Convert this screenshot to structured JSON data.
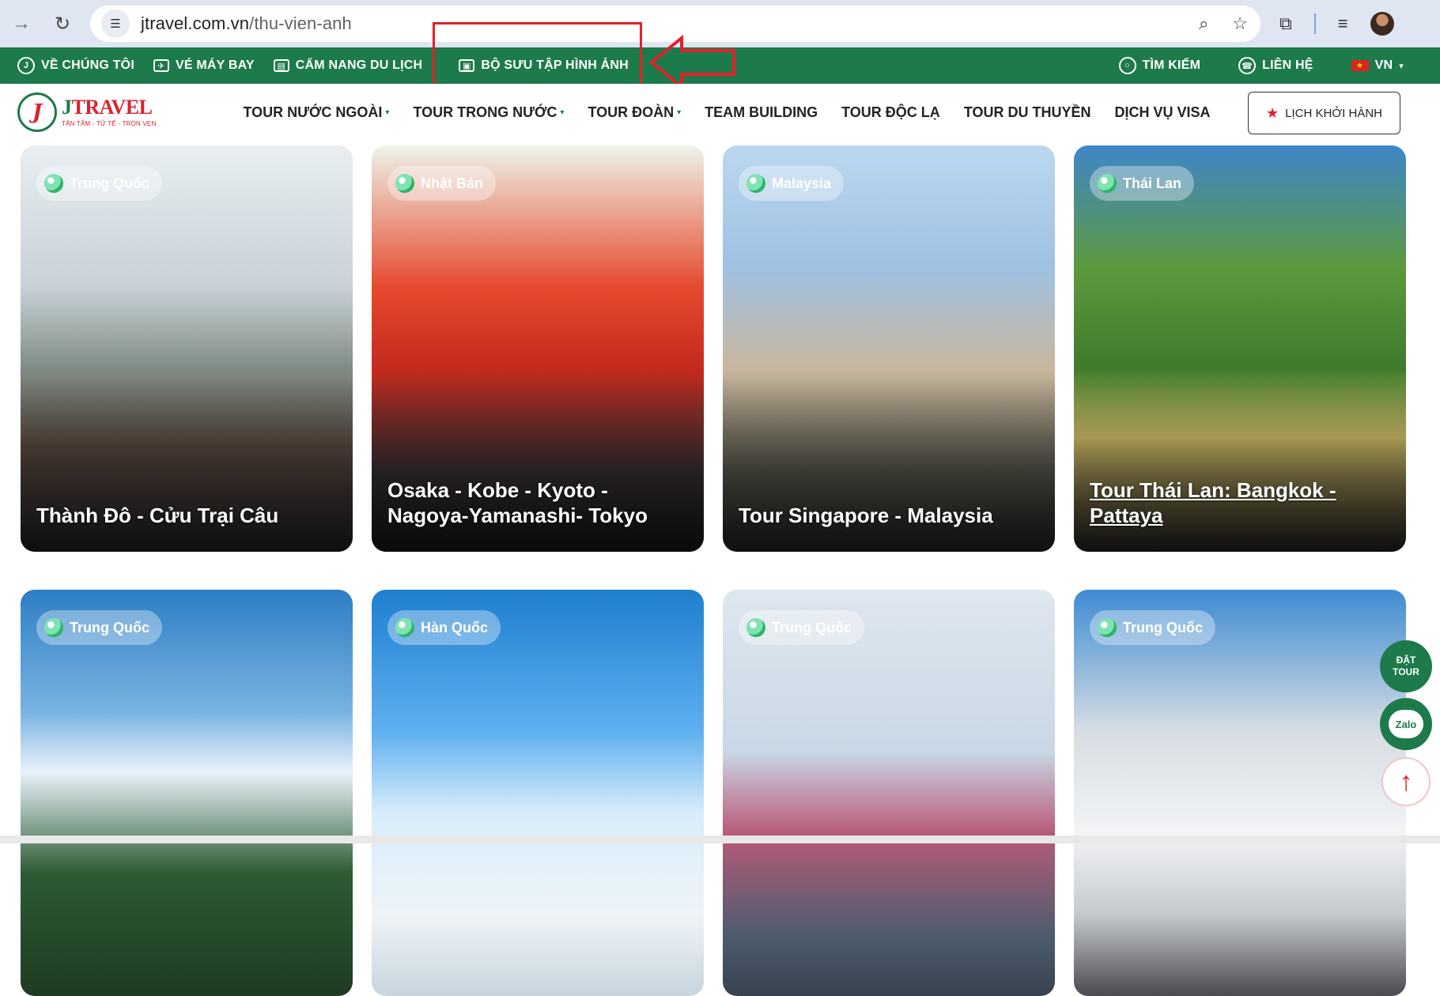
{
  "browser": {
    "url_host": "jtravel.com.vn",
    "url_path": "/thu-vien-anh",
    "icons": [
      "forward-icon",
      "reload-icon",
      "site-info-icon",
      "zoom-icon",
      "bookmark-star-icon",
      "extensions-icon",
      "media-icon",
      "profile-avatar"
    ]
  },
  "topbar": {
    "left": [
      {
        "label": "VỀ CHÚNG TÔI",
        "icon": "logo-icon"
      },
      {
        "label": "VÉ MÁY BAY",
        "icon": "ticket-icon"
      },
      {
        "label": "CẨM NANG DU LỊCH",
        "icon": "book-icon"
      },
      {
        "label": "BỘ SƯU TẬP HÌNH ẢNH",
        "icon": "image-icon"
      }
    ],
    "right": [
      {
        "label": "TÌM KIẾM",
        "icon": "search-icon"
      },
      {
        "label": "LIÊN HỆ",
        "icon": "headset-icon"
      },
      {
        "label": "VN",
        "icon": "vietnam-flag-icon"
      }
    ],
    "colors": {
      "bar": "#1d7a4a",
      "annotation": "#e3202a"
    }
  },
  "logo": {
    "name_j": "J",
    "name_rest": "TRAVEL",
    "mark": "J",
    "tagline": "TẬN TÂM - TỬ TẾ - TRỌN VẸN"
  },
  "menu": [
    {
      "label": "TOUR NƯỚC NGOÀI",
      "dropdown": true
    },
    {
      "label": "TOUR TRONG NƯỚC",
      "dropdown": true
    },
    {
      "label": "TOUR ĐOÀN",
      "dropdown": true
    },
    {
      "label": "TEAM BUILDING",
      "dropdown": false
    },
    {
      "label": "TOUR ĐỘC LẠ",
      "dropdown": false
    },
    {
      "label": "TOUR DU THUYỀN",
      "dropdown": false
    },
    {
      "label": "DỊCH VỤ VISA",
      "dropdown": false
    }
  ],
  "depart_button": "LỊCH KHỞI HÀNH",
  "gallery": [
    {
      "country": "Trung Quốc",
      "caption": "Thành Đô - Cửu Trại Câu"
    },
    {
      "country": "Nhật Bản",
      "caption": "Osaka - Kobe - Kyoto - Nagoya-Yamanashi- Tokyo"
    },
    {
      "country": "Malaysia",
      "caption": "Tour Singapore - Malaysia"
    },
    {
      "country": "Thái Lan",
      "caption": "Tour Thái Lan: Bangkok - Pattaya"
    },
    {
      "country": "Trung Quốc",
      "caption": ""
    },
    {
      "country": "Hàn Quốc",
      "caption": ""
    },
    {
      "country": "Trung Quốc",
      "caption": ""
    },
    {
      "country": "Trung Quốc",
      "caption": ""
    }
  ],
  "floating": {
    "book_line1": "ĐẶT",
    "book_line2": "TOUR",
    "zalo": "Zalo",
    "back_to_top": "↑"
  }
}
